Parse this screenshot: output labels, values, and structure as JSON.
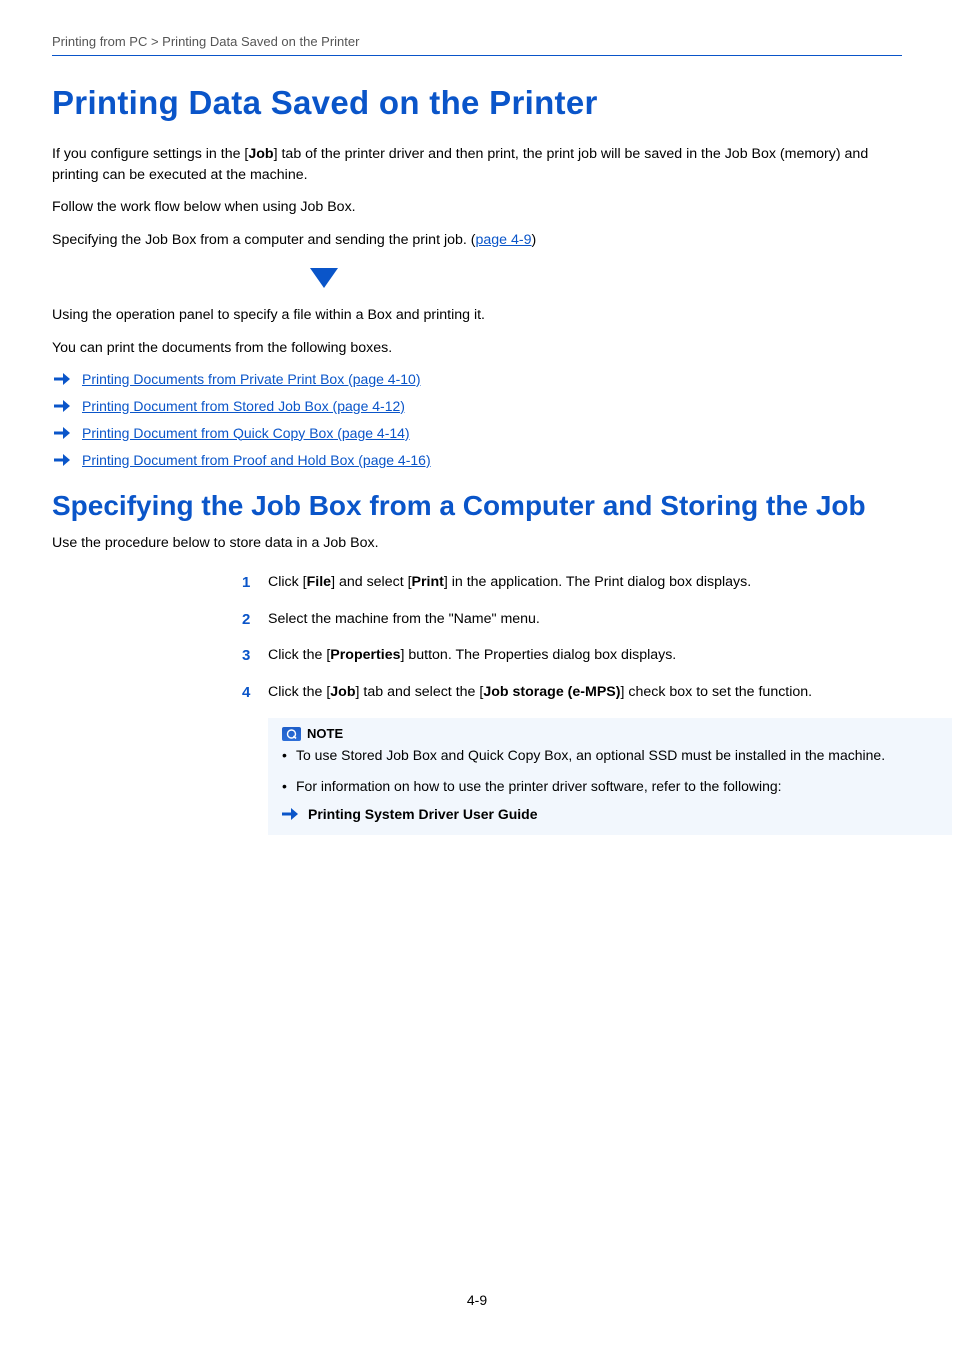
{
  "breadcrumb": "Printing from PC > Printing Data Saved on the Printer",
  "h1": "Printing Data Saved on the Printer",
  "intro": {
    "p1a": "If you configure settings in the [",
    "p1b": "Job",
    "p1c": "] tab of the printer driver and then print, the print job will be saved in the Job Box (memory) and printing can be executed at the machine.",
    "p2": "Follow the work flow below when using Job Box.",
    "p3a": "Specifying the Job Box from a computer and sending the print job. (",
    "p3_ref": "page 4-9",
    "p3b": ")",
    "p4": "Using the operation panel to specify a file within a Box and printing it.",
    "p5": "You can print the documents from the following boxes."
  },
  "links": [
    {
      "label": "Printing Documents from Private Print Box (page 4-10)"
    },
    {
      "label": "Printing Document from Stored Job Box (page 4-12)"
    },
    {
      "label": "Printing Document from Quick Copy Box (page 4-14)"
    },
    {
      "label": "Printing Document from Proof and Hold Box (page 4-16)"
    }
  ],
  "h2": "Specifying the Job Box from a Computer and Storing the Job",
  "h2_body": "Use the procedure below to store data in a Job Box.",
  "steps": {
    "s1a": "Click [",
    "s1b": "File",
    "s1c": "] and select [",
    "s1d": "Print",
    "s1e": "] in the application. The Print dialog box displays.",
    "s2": "Select the machine from the \"Name\" menu.",
    "s3a": "Click the [",
    "s3b": "Properties",
    "s3c": "] button. The Properties dialog box displays.",
    "s4a": "Click the [",
    "s4b": "Job",
    "s4c": "] tab and select the [",
    "s4d": "Job storage (e-MPS)",
    "s4e": "] check box to set the function."
  },
  "note": {
    "title": "NOTE",
    "items": [
      "To use Stored Job Box and Quick Copy Box, an optional SSD must be installed in the machine.",
      "For information on how to use the printer driver software, refer to the following:"
    ],
    "ref": "Printing System Driver User Guide"
  },
  "markers": {
    "m1": "1",
    "m2": "2",
    "m3": "3",
    "m4": "4"
  },
  "page_number": "4-9"
}
